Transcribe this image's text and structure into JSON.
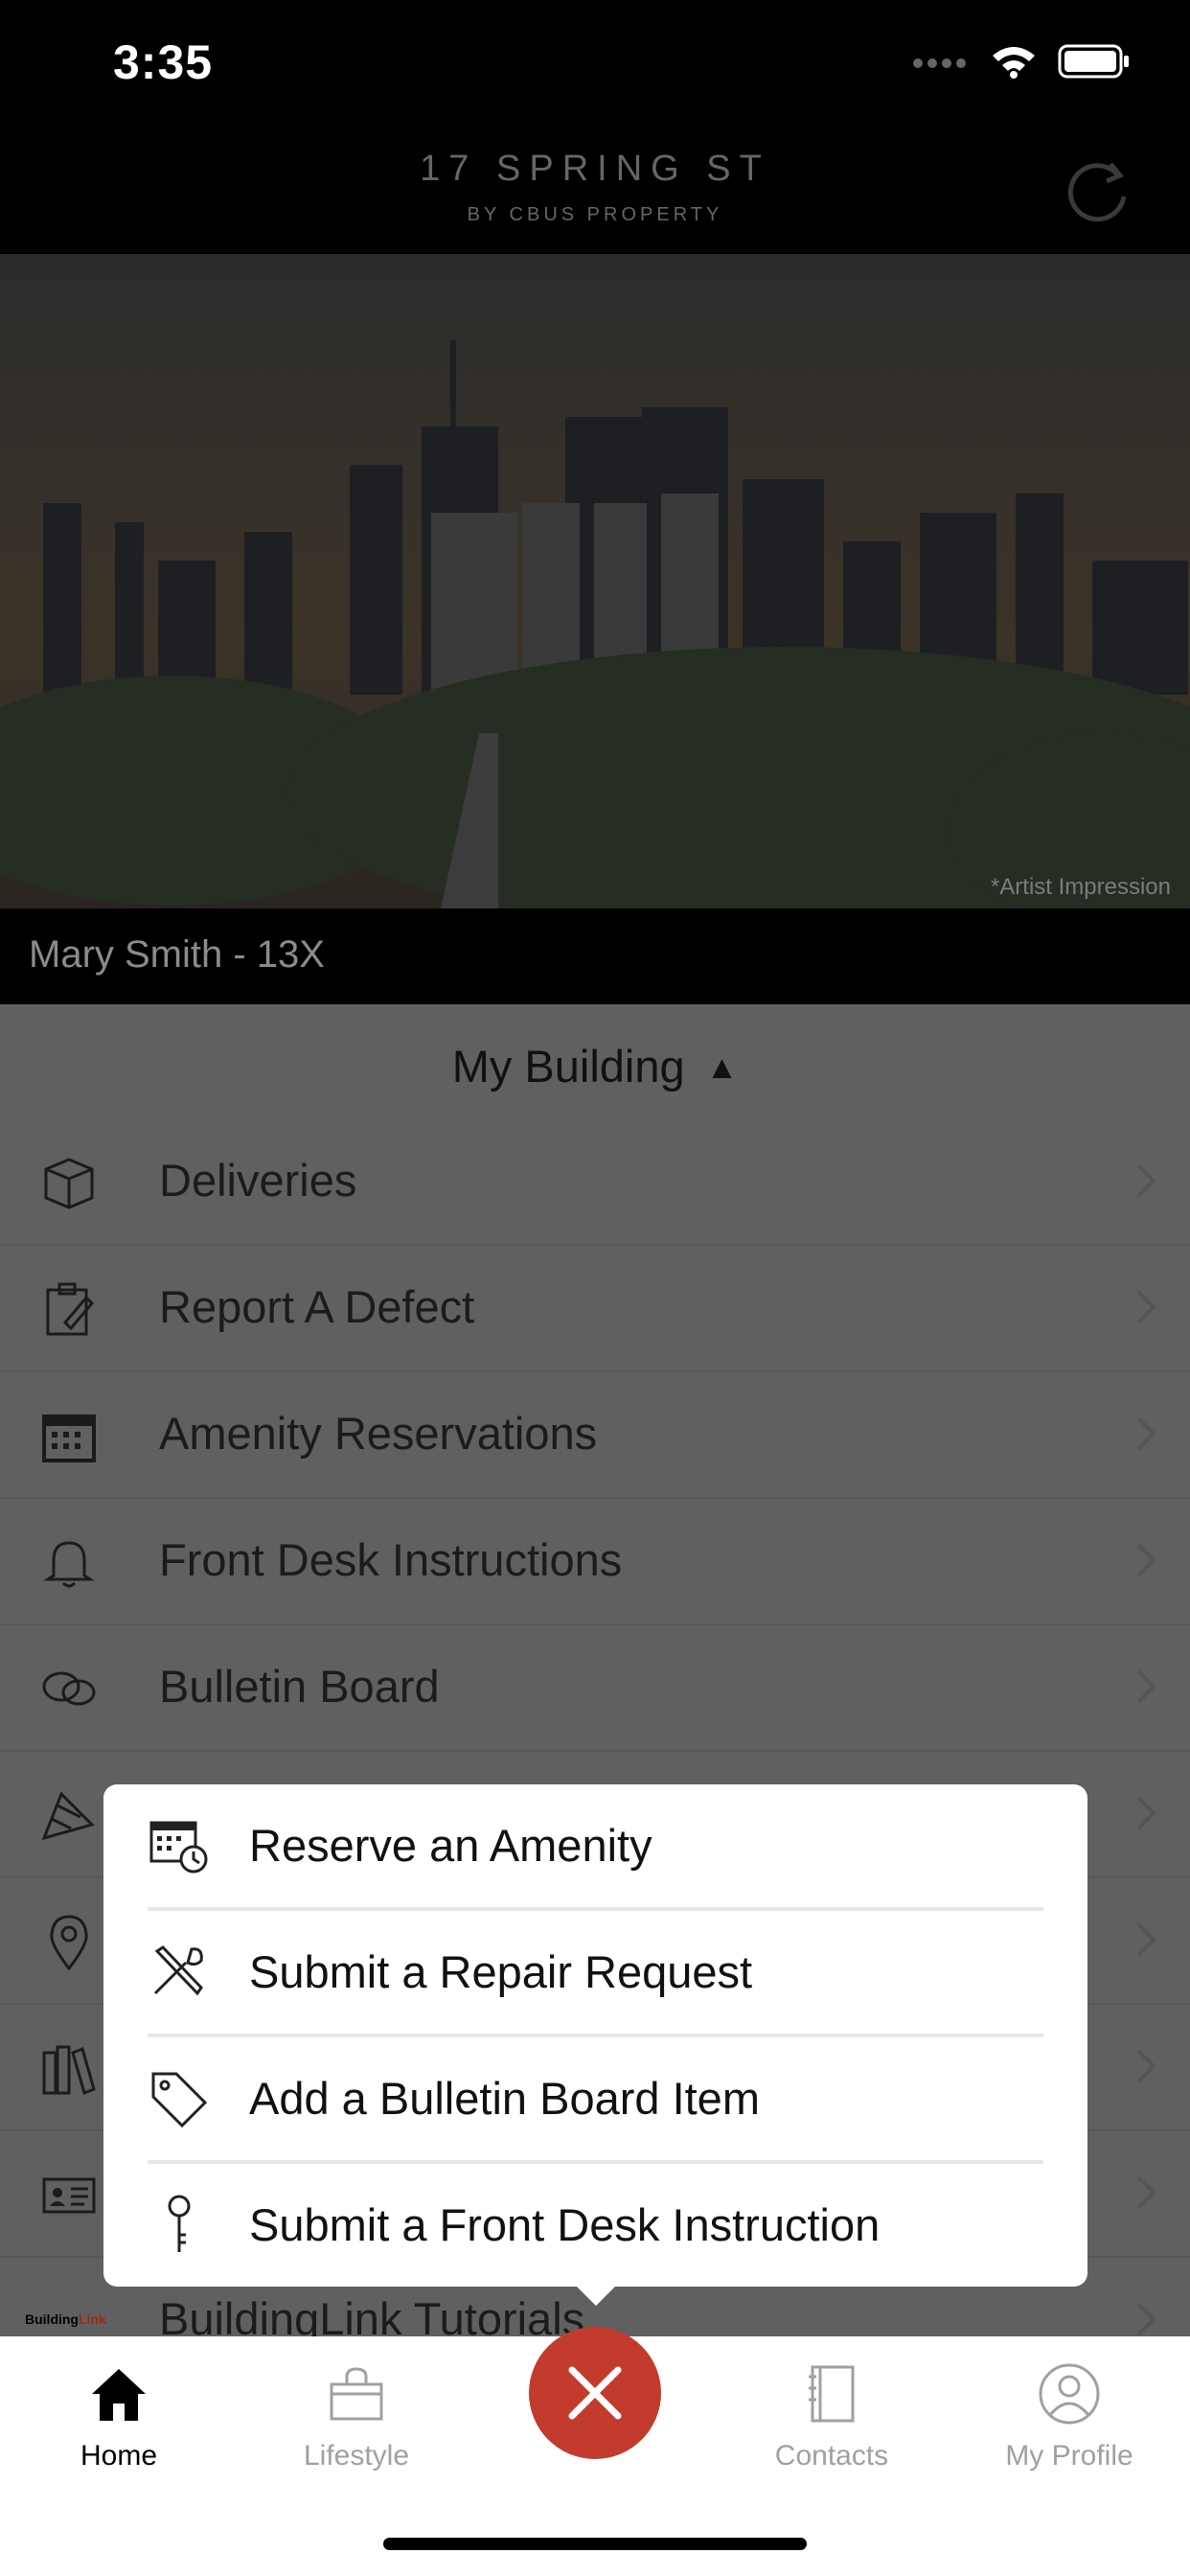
{
  "status_bar": {
    "time": "3:35"
  },
  "header": {
    "brand_line1": "17 SPRING ST",
    "brand_line2": "BY CBUS PROPERTY"
  },
  "hero": {
    "caption": "*Artist Impression"
  },
  "resident": {
    "label": "Mary Smith - 13X"
  },
  "section": {
    "title": "My Building",
    "toggle_glyph": "▲"
  },
  "menu": {
    "items": [
      {
        "label": "Deliveries",
        "icon": "package-icon"
      },
      {
        "label": "Report A Defect",
        "icon": "clipboard-pencil-icon"
      },
      {
        "label": "Amenity Reservations",
        "icon": "calendar-icon"
      },
      {
        "label": "Front Desk Instructions",
        "icon": "bell-icon"
      },
      {
        "label": "Bulletin Board",
        "icon": "chat-bubbles-icon"
      },
      {
        "label": "",
        "icon": "party-icon"
      },
      {
        "label": "",
        "icon": "location-pin-icon"
      },
      {
        "label": "",
        "icon": "library-books-icon"
      },
      {
        "label": "",
        "icon": "id-card-icon"
      },
      {
        "label": "BuildingLink Tutorials",
        "icon": "buildinglink-logo"
      }
    ]
  },
  "buildinglink_logo": {
    "part1": "Building",
    "part2": "Link"
  },
  "popup": {
    "items": [
      {
        "label": "Reserve an Amenity",
        "icon": "calendar-clock-icon"
      },
      {
        "label": "Submit a Repair Request",
        "icon": "tools-icon"
      },
      {
        "label": "Add a Bulletin Board Item",
        "icon": "tag-icon"
      },
      {
        "label": "Submit a Front Desk Instruction",
        "icon": "key-icon"
      }
    ]
  },
  "tabbar": {
    "tabs": [
      {
        "label": "Home",
        "active": true
      },
      {
        "label": "Lifestyle",
        "active": false
      },
      {
        "label": "Contacts",
        "active": false
      },
      {
        "label": "My Profile",
        "active": false
      }
    ]
  },
  "colors": {
    "accent": "#c23b2d",
    "overlay": "#606060",
    "header_bg": "#000000"
  }
}
